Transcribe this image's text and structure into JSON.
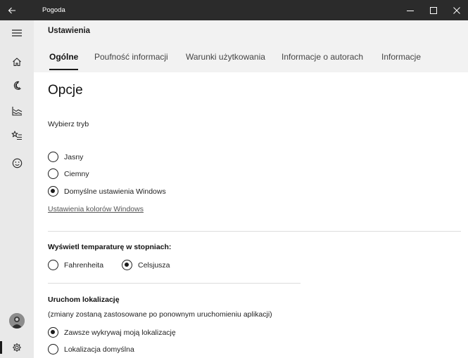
{
  "window": {
    "title": "Pogoda",
    "back_icon": "back-arrow-icon",
    "controls": [
      "minimize-icon",
      "maximize-icon",
      "close-icon"
    ]
  },
  "sidebar": {
    "items": [
      {
        "icon": "hamburger-menu-icon"
      },
      {
        "icon": "home-icon"
      },
      {
        "icon": "moon-crescent-icon"
      },
      {
        "icon": "chart-lines-icon"
      },
      {
        "icon": "star-list-icon"
      },
      {
        "icon": "smiley-icon"
      }
    ],
    "avatar": "avatar",
    "settings_icon": "gear-icon"
  },
  "header": {
    "title": "Ustawienia"
  },
  "tabs": [
    {
      "label": "Ogólne",
      "active": true
    },
    {
      "label": "Poufność informacji",
      "active": false
    },
    {
      "label": "Warunki użytkowania",
      "active": false
    },
    {
      "label": "Informacje o autorach",
      "active": false
    },
    {
      "label": "Informacje",
      "active": false
    }
  ],
  "main": {
    "section_title": "Opcje",
    "mode": {
      "label": "Wybierz tryb",
      "options": [
        {
          "label": "Jasny",
          "checked": false
        },
        {
          "label": "Ciemny",
          "checked": false
        },
        {
          "label": "Domyślne ustawienia Windows",
          "checked": true
        }
      ],
      "link": "Ustawienia kolorów Windows"
    },
    "temperature": {
      "label": "Wyświetl temparaturę w stopniach:",
      "options": [
        {
          "label": "Fahrenheita",
          "checked": false
        },
        {
          "label": "Celsjusza",
          "checked": true
        }
      ]
    },
    "location": {
      "label": "Uruchom lokalizację",
      "note": "(zmiany zostaną zastosowane po ponownym uruchomieniu aplikacji)",
      "options": [
        {
          "label": "Zawsze wykrywaj moją lokalizację",
          "checked": true
        },
        {
          "label": "Lokalizacja domyślna",
          "checked": false
        }
      ]
    }
  },
  "colors": {
    "titlebar": "#2b2b2b",
    "sidebar": "#e9e9e9",
    "header": "#f2f2f2",
    "accent": "#1a1a1a"
  }
}
